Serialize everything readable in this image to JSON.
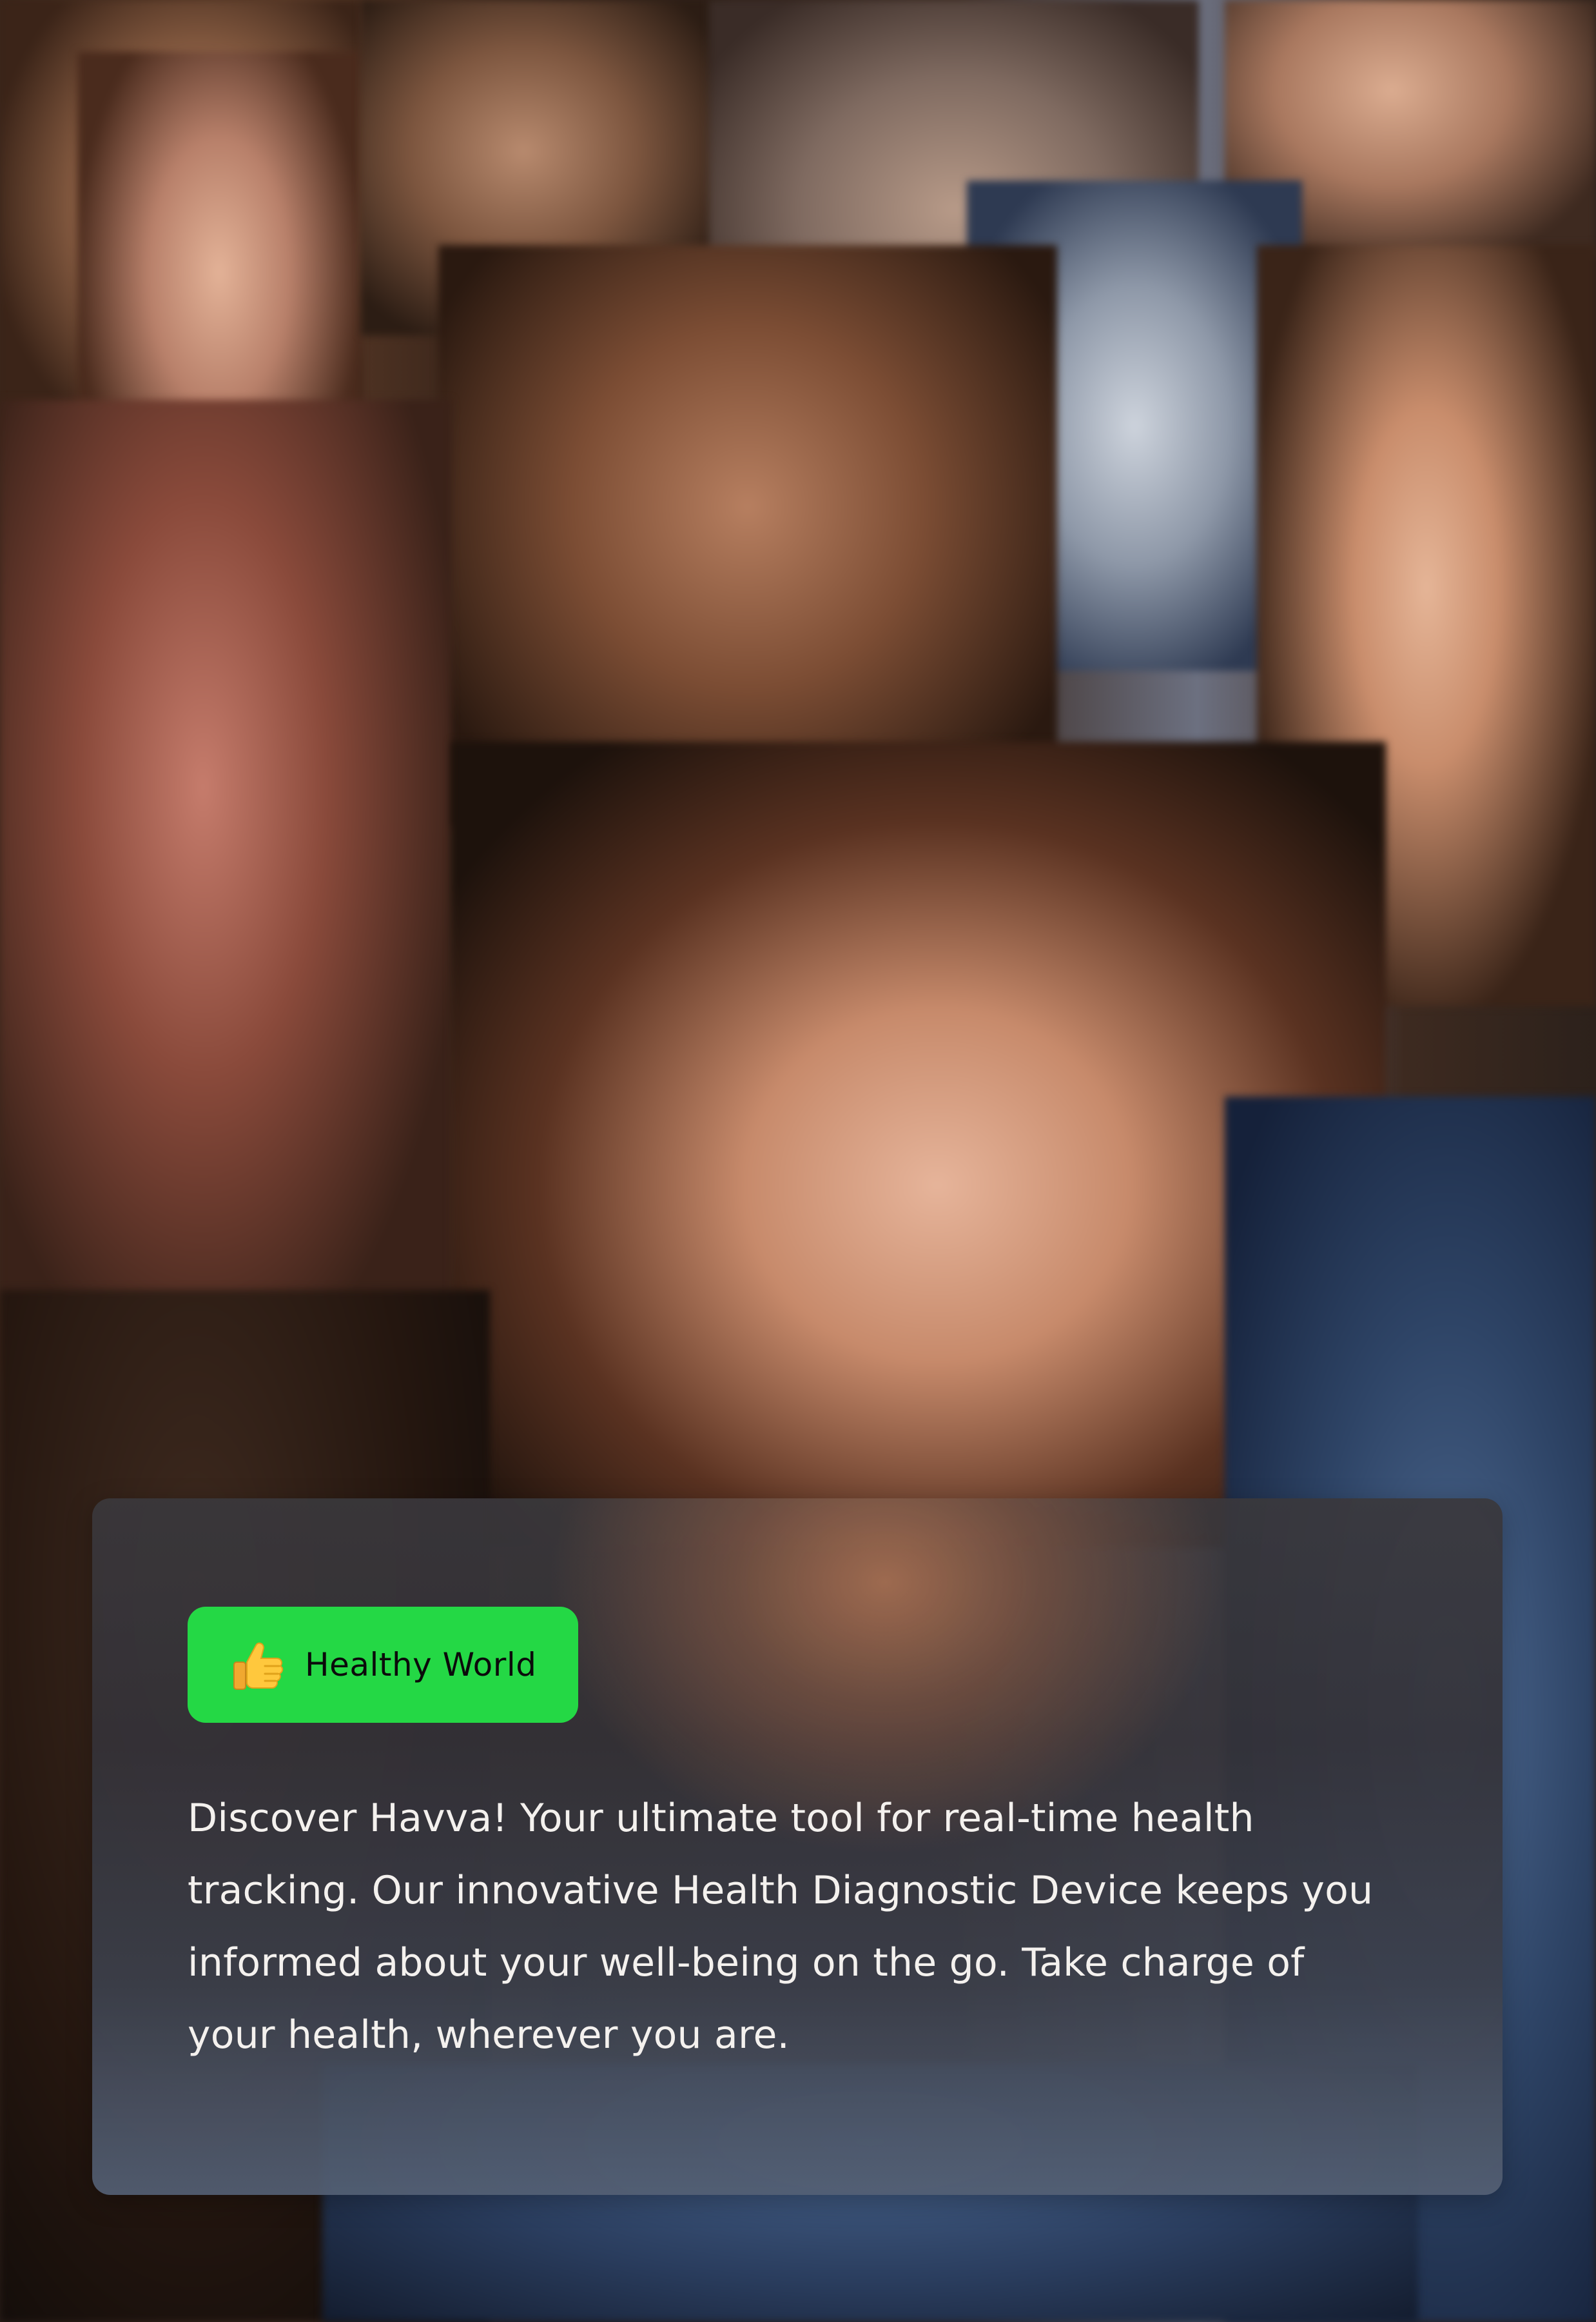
{
  "badge": {
    "icon": "thumbs-up-icon",
    "label": "Healthy World",
    "color": "#24d845"
  },
  "description": "Discover Havva! Your ultimate tool for real-time health tracking. Our innovative Health Diagnostic Device keeps you informed about your well-being on the go. Take charge of your health, wherever you are.",
  "colors": {
    "card_text": "#f4f1ee",
    "badge_text": "#0b0b0b"
  }
}
